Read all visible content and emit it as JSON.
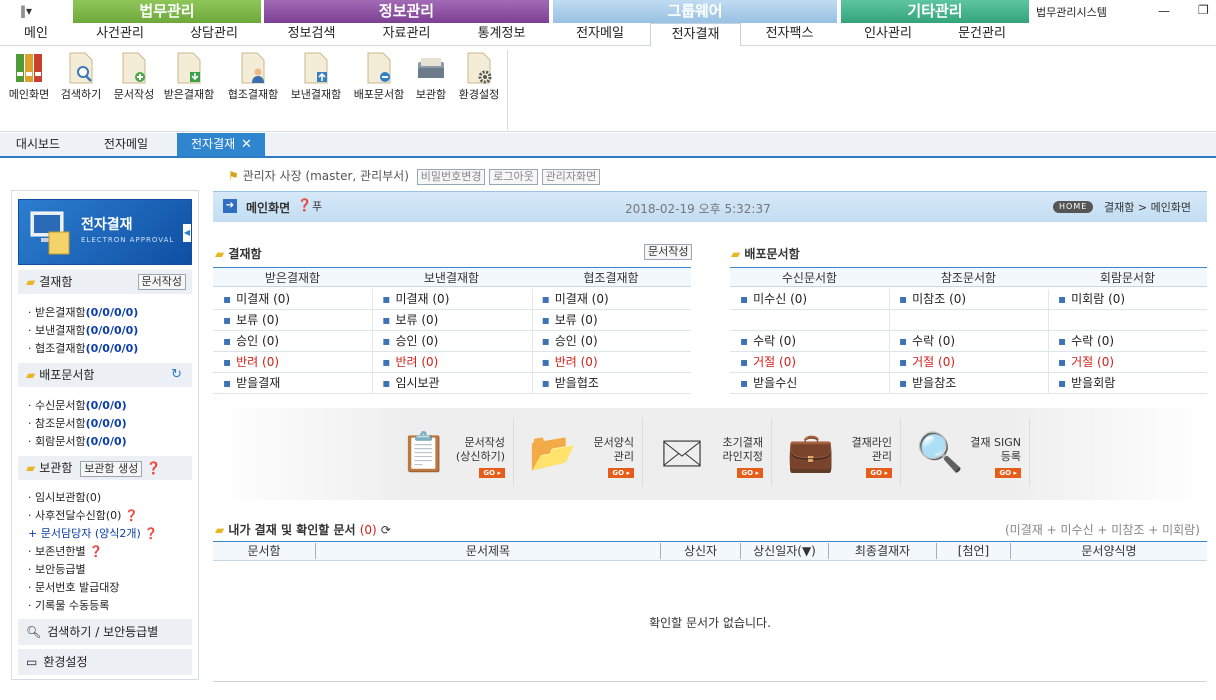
{
  "window": {
    "app_title": "법무관리시스템"
  },
  "menu": {
    "home": "메인",
    "groups": [
      {
        "label": "법무관리",
        "color": "#7cb342",
        "items": [
          "사건관리",
          "상담관리"
        ]
      },
      {
        "label": "정보관리",
        "color": "#8e4fa3",
        "items": [
          "정보검색",
          "자료관리",
          "통계정보"
        ]
      },
      {
        "label": "그룹웨어",
        "color": "#9fc6e6",
        "items": [
          "전자메일",
          "전자결재",
          "전자팩스"
        ]
      },
      {
        "label": "기타관리",
        "color": "#3fb48a",
        "items": [
          "인사관리",
          "문건관리"
        ]
      }
    ]
  },
  "ribbon": [
    "메인화면",
    "검색하기",
    "문서작성",
    "받은결재함",
    "협조결재함",
    "보낸결재함",
    "배포문서함",
    "보관함",
    "환경설정"
  ],
  "tabs": [
    "대시보드",
    "전자메일",
    "전자결재"
  ],
  "userbar": {
    "text": "관리자 사장 (master, 관리부서)",
    "btn1": "비밀번호변경",
    "btn2": "로그아웃",
    "btn3": "관리자화면"
  },
  "sidebar": {
    "banner_title": "전자결재",
    "banner_sub": "ELECTRON APPROVAL",
    "sec1": "결재함",
    "sec1_btn": "문서작성",
    "sec1_items": [
      {
        "label": "받은결재함",
        "count": "(0/0/0/0)"
      },
      {
        "label": "보낸결재함",
        "count": "(0/0/0/0)"
      },
      {
        "label": "협조결재함",
        "count": "(0/0/0/0)"
      }
    ],
    "sec2": "배포문서함",
    "sec2_items": [
      {
        "label": "수신문서함",
        "count": "(0/0/0)"
      },
      {
        "label": "참조문서함",
        "count": "(0/0/0)"
      },
      {
        "label": "회람문서함",
        "count": "(0/0/0)"
      }
    ],
    "sec3": "보관함",
    "sec3_btn": "보관함 생성",
    "sec3_items": [
      "임시보관함(0)",
      "사후전달수신함(0)",
      "문서담당자 (양식2개)",
      "보존년한별",
      "보안등급별",
      "문서번호 발급대장",
      "기록물 수동등록"
    ],
    "sec4": "검색하기 / 보안등급별",
    "sec5": "환경설정"
  },
  "main": {
    "title": "메인화면",
    "datetime": "2018-02-19 오후 5:32:37",
    "home_badge": "HOME",
    "path": "결재함 > 메인화면",
    "box1_title": "결재함",
    "box1_btn": "문서작성",
    "box1_cols": [
      "받은결재함",
      "보낸결재함",
      "협조결재함"
    ],
    "box1_rows": [
      [
        "미결재 (0)",
        "미결재 (0)",
        "미결재 (0)"
      ],
      [
        "보류 (0)",
        "보류 (0)",
        "보류 (0)"
      ],
      [
        "승인 (0)",
        "승인 (0)",
        "승인 (0)"
      ],
      [
        "반려 (0)",
        "반려 (0)",
        "반려 (0)"
      ],
      [
        "받을결재",
        "임시보관",
        "받을협조"
      ]
    ],
    "box2_title": "배포문서함",
    "box2_cols": [
      "수신문서함",
      "참조문서함",
      "회람문서함"
    ],
    "box2_rows": [
      [
        "미수신 (0)",
        "미참조 (0)",
        "미회람 (0)"
      ],
      [
        "",
        "",
        ""
      ],
      [
        "수락 (0)",
        "수락 (0)",
        "수락 (0)"
      ],
      [
        "거절 (0)",
        "거절 (0)",
        "거절 (0)"
      ],
      [
        "받을수신",
        "받을참조",
        "받을회람"
      ]
    ],
    "quick": [
      {
        "l1": "문서작성",
        "l2": "(상신하기)"
      },
      {
        "l1": "문서양식",
        "l2": "관리"
      },
      {
        "l1": "초기결재",
        "l2": "라인지정"
      },
      {
        "l1": "결재라인",
        "l2": "관리"
      },
      {
        "l1": "결재 SIGN",
        "l2": "등록"
      }
    ],
    "go": "GO",
    "list_title": "내가 결재 및 확인할 문서",
    "list_count": "(0)",
    "list_hint": "(미결재 + 미수신 + 미참조 + 미회람)",
    "list_cols": [
      "문서함",
      "문서제목",
      "상신자",
      "상신일자(▼)",
      "최종결재자",
      "[첨언]",
      "문서양식명"
    ],
    "empty": "확인할 문서가 없습니다."
  }
}
